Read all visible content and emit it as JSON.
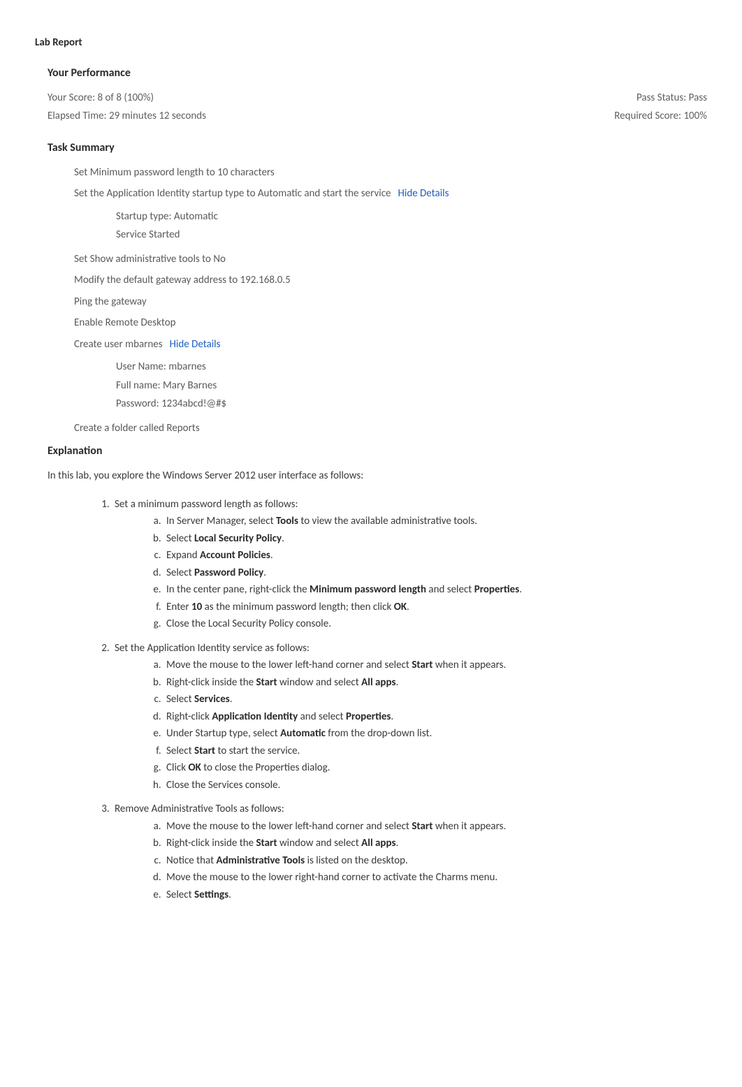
{
  "title": "Lab Report",
  "performance": {
    "heading": "Your Performance",
    "score_label": "Your Score: 8 of 8 (100%)",
    "pass_status": "Pass Status: Pass",
    "elapsed_time": "Elapsed Time: 29 minutes 12 seconds",
    "required_score": "Required Score: 100%"
  },
  "task_summary": {
    "heading": "Task Summary",
    "tasks": [
      {
        "text": "Set Minimum password length to 10 characters",
        "link": ""
      },
      {
        "text": "Set the Application Identity startup type to Automatic and start the service",
        "link": "Hide Details",
        "details": [
          "Startup type: Automatic",
          "Service Started"
        ]
      },
      {
        "text": "Set Show administrative tools to No",
        "link": ""
      },
      {
        "text": "Modify the default gateway address to 192.168.0.5",
        "link": ""
      },
      {
        "text": "Ping the gateway",
        "link": ""
      },
      {
        "text": "Enable Remote Desktop",
        "link": ""
      },
      {
        "text": "Create user mbarnes",
        "link": "Hide Details",
        "details": [
          "User Name: mbarnes",
          "Full name: Mary Barnes",
          "Password: 1234abcd!@#$"
        ]
      },
      {
        "text": "Create a folder called Reports",
        "link": ""
      }
    ]
  },
  "explanation": {
    "heading": "Explanation",
    "intro": "In this lab, you explore the Windows Server 2012 user interface as follows:",
    "steps": [
      {
        "lead": "Set a minimum password length as follows:",
        "sub": [
          [
            "In Server Manager, select ",
            "Tools",
            " to view the available administrative tools."
          ],
          [
            "Select ",
            "Local Security Policy",
            "."
          ],
          [
            "Expand ",
            "Account Policies",
            "."
          ],
          [
            "Select ",
            "Password Policy",
            "."
          ],
          [
            "In the center pane, right-click the ",
            "Minimum password length",
            " and select ",
            "Properties",
            "."
          ],
          [
            "Enter ",
            "10",
            " as the minimum password length; then click ",
            "OK",
            "."
          ],
          [
            "Close the Local Security Policy console."
          ]
        ]
      },
      {
        "lead": "Set the Application Identity service as follows:",
        "sub": [
          [
            "Move the mouse to the lower left-hand corner and select ",
            "Start",
            " when it appears."
          ],
          [
            "Right-click inside the ",
            "Start",
            " window and select ",
            "All apps",
            "."
          ],
          [
            "Select ",
            "Services",
            "."
          ],
          [
            "Right-click ",
            "Application Identity",
            " and select ",
            "Properties",
            "."
          ],
          [
            "Under Startup type, select ",
            "Automatic",
            " from the drop-down list."
          ],
          [
            "Select ",
            "Start",
            " to start the service."
          ],
          [
            "Click ",
            "OK",
            " to close the Properties dialog."
          ],
          [
            "Close the Services console."
          ]
        ]
      },
      {
        "lead": "Remove Administrative Tools as follows:",
        "sub": [
          [
            "Move the mouse to the lower left-hand corner and select ",
            "Start",
            " when it appears."
          ],
          [
            "Right-click inside the ",
            "Start",
            " window and select ",
            "All apps",
            "."
          ],
          [
            "Notice that ",
            "Administrative Tools",
            " is listed on the desktop."
          ],
          [
            "Move the mouse to the lower right-hand corner to activate the Charms menu."
          ],
          [
            "Select ",
            "Settings",
            "."
          ]
        ]
      }
    ]
  }
}
